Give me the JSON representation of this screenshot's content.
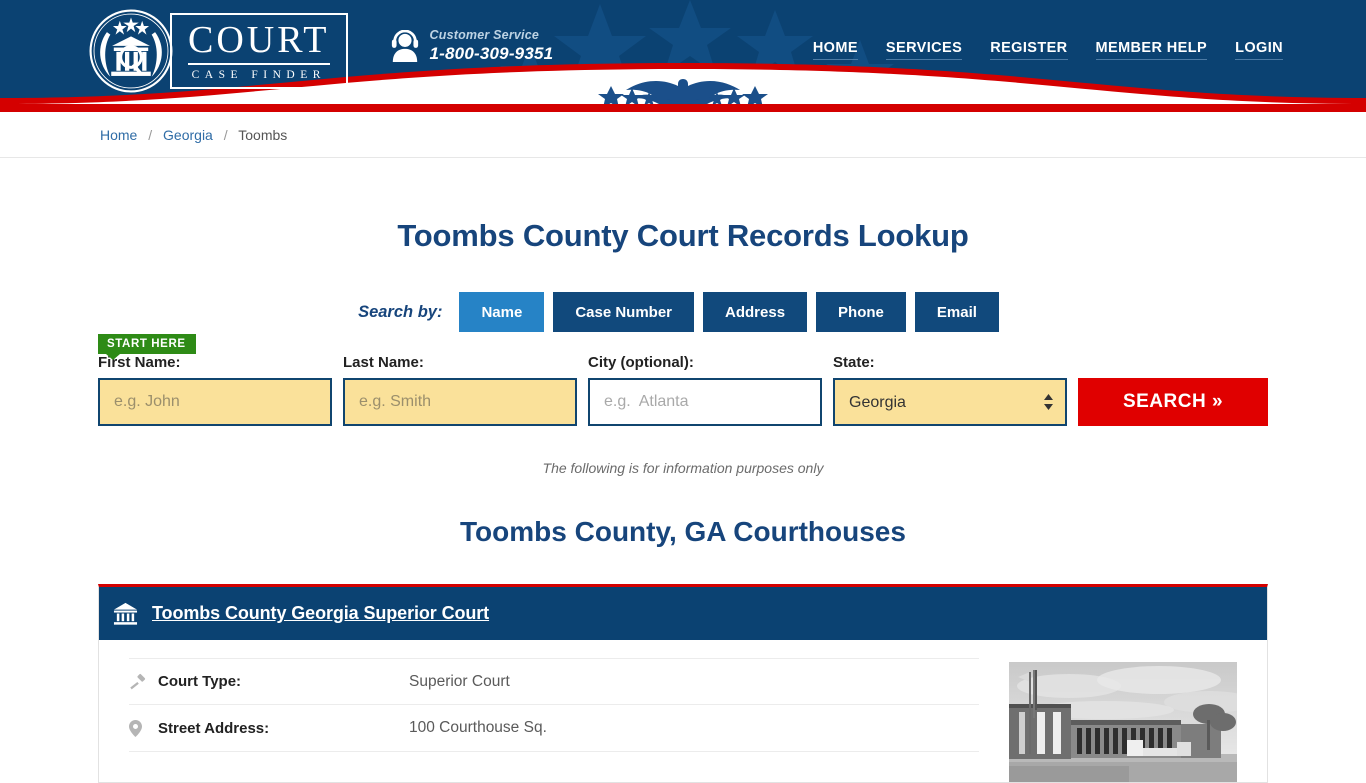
{
  "header": {
    "logo": {
      "title": "COURT",
      "subtitle": "CASE FINDER",
      "icon": "court-seal-icon"
    },
    "customer_service": {
      "label": "Customer Service",
      "phone": "1-800-309-9351",
      "icon": "headset-support-icon"
    },
    "nav": [
      {
        "label": "HOME"
      },
      {
        "label": "SERVICES"
      },
      {
        "label": "REGISTER"
      },
      {
        "label": "MEMBER HELP"
      },
      {
        "label": "LOGIN"
      }
    ],
    "decoration": {
      "eagle": "eagle-icon",
      "stars": "stars-decoration"
    },
    "colors": {
      "navy": "#0b4272",
      "red": "#d40000",
      "accent_blue": "#2683c6"
    }
  },
  "breadcrumb": {
    "items": [
      {
        "label": "Home",
        "link": true
      },
      {
        "label": "Georgia",
        "link": true
      },
      {
        "label": "Toombs",
        "link": false
      }
    ],
    "separator": "/"
  },
  "main": {
    "page_title": "Toombs County Court Records Lookup",
    "search_by_label": "Search by:",
    "tabs": [
      {
        "label": "Name",
        "active": true
      },
      {
        "label": "Case Number",
        "active": false
      },
      {
        "label": "Address",
        "active": false
      },
      {
        "label": "Phone",
        "active": false
      },
      {
        "label": "Email",
        "active": false
      }
    ],
    "start_here_badge": "START HERE",
    "form": {
      "first_name": {
        "label": "First Name:",
        "placeholder": "e.g. John",
        "value": ""
      },
      "last_name": {
        "label": "Last Name:",
        "placeholder": "e.g. Smith",
        "value": ""
      },
      "city": {
        "label": "City (optional):",
        "placeholder": "e.g.  Atlanta",
        "value": ""
      },
      "state": {
        "label": "State:",
        "value": "Georgia",
        "options": [
          "Georgia"
        ]
      },
      "search_button": "SEARCH  »"
    },
    "disclaimer": "The following is for information purposes only",
    "section_title": "Toombs County, GA Courthouses"
  },
  "court_card": {
    "icon": "bank-courthouse-icon",
    "title": "Toombs County Georgia Superior Court",
    "details": [
      {
        "icon": "gavel-icon",
        "label": "Court Type:",
        "value": "Superior Court"
      },
      {
        "icon": "map-pin-icon",
        "label": "Street Address:",
        "value": "100 Courthouse Sq."
      }
    ],
    "photo_alt": "courthouse-photo"
  }
}
